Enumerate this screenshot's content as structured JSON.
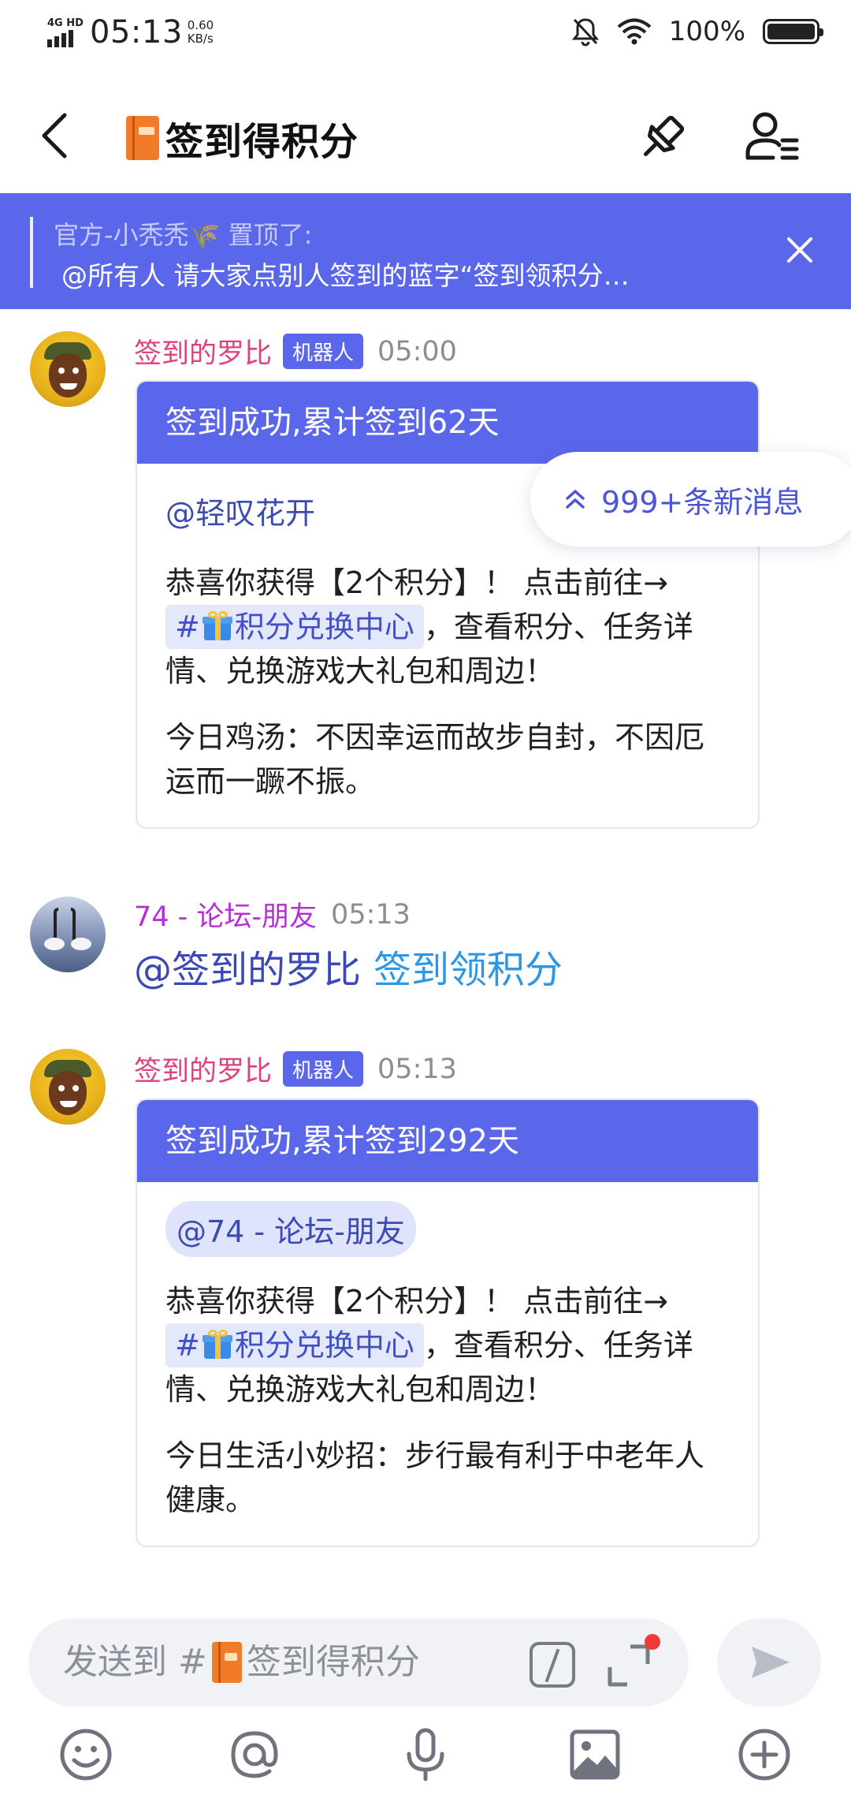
{
  "status_bar": {
    "network": "4G HD",
    "time": "05:13",
    "speed_value": "0.60",
    "speed_unit": "KB/s",
    "battery": "100%"
  },
  "header": {
    "title": "签到得积分",
    "icons": [
      "back-icon",
      "pin-icon",
      "members-icon"
    ]
  },
  "pinned": {
    "meta": "官方-小秃秃🌾 置顶了:",
    "text": "@所有人 请大家点别人签到的蓝字“签到领积分…"
  },
  "messages": [
    {
      "sender": "签到的罗比",
      "tag": "机器人",
      "time": "05:00",
      "card_title": "签到成功,累计签到62天",
      "mention": "@轻叹花开",
      "para1_a": "恭喜你获得【2个积分】！ 点击前往→",
      "channel_link": "积分兑换中心",
      "para1_b": "，查看积分、任务详情、兑换游戏大礼包和周边！",
      "para2": "今日鸡汤：不因幸运而故步自封，不因厄运而一蹶不振。"
    },
    {
      "sender": "74 - 论坛-朋友",
      "time": "05:13",
      "at_text": "@签到的罗比",
      "link_text": "签到领积分"
    },
    {
      "sender": "签到的罗比",
      "tag": "机器人",
      "time": "05:13",
      "card_title": "签到成功,累计签到292天",
      "mention": "@74 - 论坛-朋友",
      "para1_a": "恭喜你获得【2个积分】！ 点击前往→",
      "channel_link": "积分兑换中心",
      "para1_b": "，查看积分、任务详情、兑换游戏大礼包和周边！",
      "para2": "今日生活小妙招：步行最有利于中老年人健康。"
    }
  ],
  "new_messages": "999+条新消息",
  "composer": {
    "placeholder_prefix": "发送到 #",
    "placeholder_channel": "签到得积分"
  },
  "toolbar": [
    "emoji-icon",
    "at-icon",
    "microphone-icon",
    "image-icon",
    "plus-icon"
  ],
  "colors": {
    "accent": "#5b67ea",
    "bot_name": "#e0427d",
    "user_name": "#b52fd6",
    "link": "#2a98e6"
  }
}
